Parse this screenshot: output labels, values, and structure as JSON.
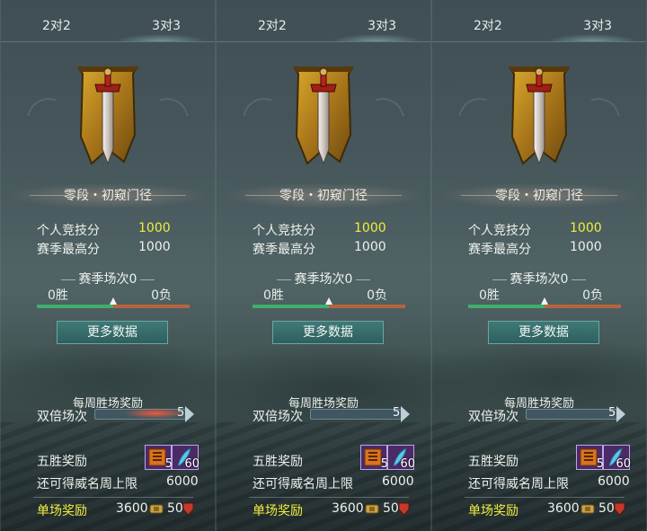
{
  "panels": [
    {
      "tabs": {
        "left": "2对2",
        "right": "3对3"
      },
      "rank": "零段・初窥门径",
      "personal_label": "个人竞技分",
      "personal_value": "1000",
      "season_high_label": "赛季最高分",
      "season_high_value": "1000",
      "season_matches": "赛季场次0",
      "wins": "0胜",
      "losses": "0负",
      "win_ratio": 0.5,
      "more_data": "更多数据",
      "weekly_title": "每周胜场奖励",
      "double_label": "双倍场次",
      "double_count": "5",
      "double_progress": 0.0,
      "five_label": "五胜奖励",
      "item1_count": "5",
      "item2_count": "60",
      "limit_label": "还可得威名周上限",
      "limit_value": "6000",
      "single_label": "单场奖励",
      "single_coin": "3600",
      "single_shield": "50"
    },
    {
      "tabs": {
        "left": "2对2",
        "right": "3对3"
      },
      "rank": "零段・初窥门径",
      "personal_label": "个人竞技分",
      "personal_value": "1000",
      "season_high_label": "赛季最高分",
      "season_high_value": "1000",
      "season_matches": "赛季场次0",
      "wins": "0胜",
      "losses": "0负",
      "win_ratio": 0.5,
      "more_data": "更多数据",
      "weekly_title": "每周胜场奖励",
      "double_label": "双倍场次",
      "double_count": "5",
      "double_progress": 0.0,
      "five_label": "五胜奖励",
      "item1_count": "5",
      "item2_count": "60",
      "limit_label": "还可得威名周上限",
      "limit_value": "6000",
      "single_label": "单场奖励",
      "single_coin": "3600",
      "single_shield": "50"
    },
    {
      "tabs": {
        "left": "2对2",
        "right": "3对3"
      },
      "rank": "零段・初窥门径",
      "personal_label": "个人竞技分",
      "personal_value": "1000",
      "season_high_label": "赛季最高分",
      "season_high_value": "1000",
      "season_matches": "赛季场次0",
      "wins": "0胜",
      "losses": "0负",
      "win_ratio": 0.5,
      "more_data": "更多数据",
      "weekly_title": "每周胜场奖励",
      "double_label": "双倍场次",
      "double_count": "5",
      "double_progress": 0.0,
      "five_label": "五胜奖励",
      "item1_count": "5",
      "item2_count": "60",
      "limit_label": "还可得威名周上限",
      "limit_value": "6000",
      "single_label": "单场奖励",
      "single_coin": "3600",
      "single_shield": "50"
    }
  ],
  "colors": {
    "score_yellow": "#f2ee3c",
    "win_green": "#3fae6e",
    "loss_orange": "#b7643e",
    "button_teal": "#3f7a78"
  },
  "icons": {
    "emblem": "sword-banner-icon",
    "item1": "tiger-scroll-icon",
    "item2": "blue-feather-icon",
    "coin": "gold-coin-icon",
    "shield": "red-shield-icon"
  }
}
